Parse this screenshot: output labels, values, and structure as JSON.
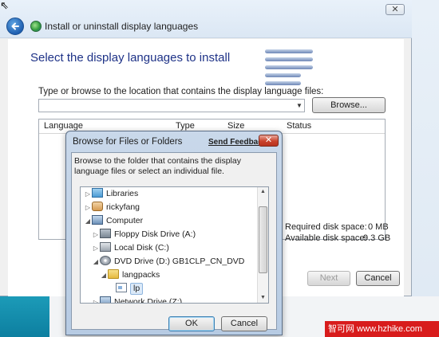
{
  "main_window": {
    "title": "Install or uninstall display languages",
    "close_glyph": "✕",
    "heading": "Select the display languages to install",
    "path_prompt": "Type or browse to the location that contains the display language files:",
    "path_value": "",
    "dropdown_glyph": "▼",
    "browse_label": "Browse...",
    "table_columns": [
      "Language",
      "Type",
      "Size",
      "Status"
    ],
    "disk_required_label": "Required disk space:",
    "disk_required_value": "0 MB",
    "disk_available_label": "Available disk space:",
    "disk_available_value": "9.3 GB",
    "next_label": "Next",
    "cancel_label": "Cancel"
  },
  "dialog": {
    "title": "Browse for Files or Folders",
    "send_feedback": "Send Feedback",
    "close_glyph": "✕",
    "description": "Browse to the folder that contains the display language files or select an individual file.",
    "tree": [
      {
        "label": "Libraries",
        "arrow": "▷",
        "icon": "libraries-icon"
      },
      {
        "label": "rickyfang",
        "arrow": "▷",
        "icon": "user-folder-icon"
      },
      {
        "label": "Computer",
        "arrow": "◢",
        "icon": "computer-icon"
      },
      {
        "label": "Floppy Disk Drive (A:)",
        "arrow": "▷",
        "icon": "floppy-icon"
      },
      {
        "label": "Local Disk (C:)",
        "arrow": "▷",
        "icon": "hard-disk-icon"
      },
      {
        "label": "DVD Drive (D:) GB1CLP_CN_DVD",
        "arrow": "◢",
        "icon": "dvd-icon"
      },
      {
        "label": "langpacks",
        "arrow": "◢",
        "icon": "folder-icon"
      },
      {
        "label": "lp",
        "arrow": "",
        "icon": "file-icon",
        "selected": true
      },
      {
        "label": "Network Drive (Z:)",
        "arrow": "▷",
        "icon": "network-drive-icon"
      }
    ],
    "scroll_up_glyph": "▲",
    "scroll_down_glyph": "▼",
    "ok_label": "OK",
    "cancel_label": "Cancel"
  },
  "watermark": "智可网 www.hzhike.com"
}
